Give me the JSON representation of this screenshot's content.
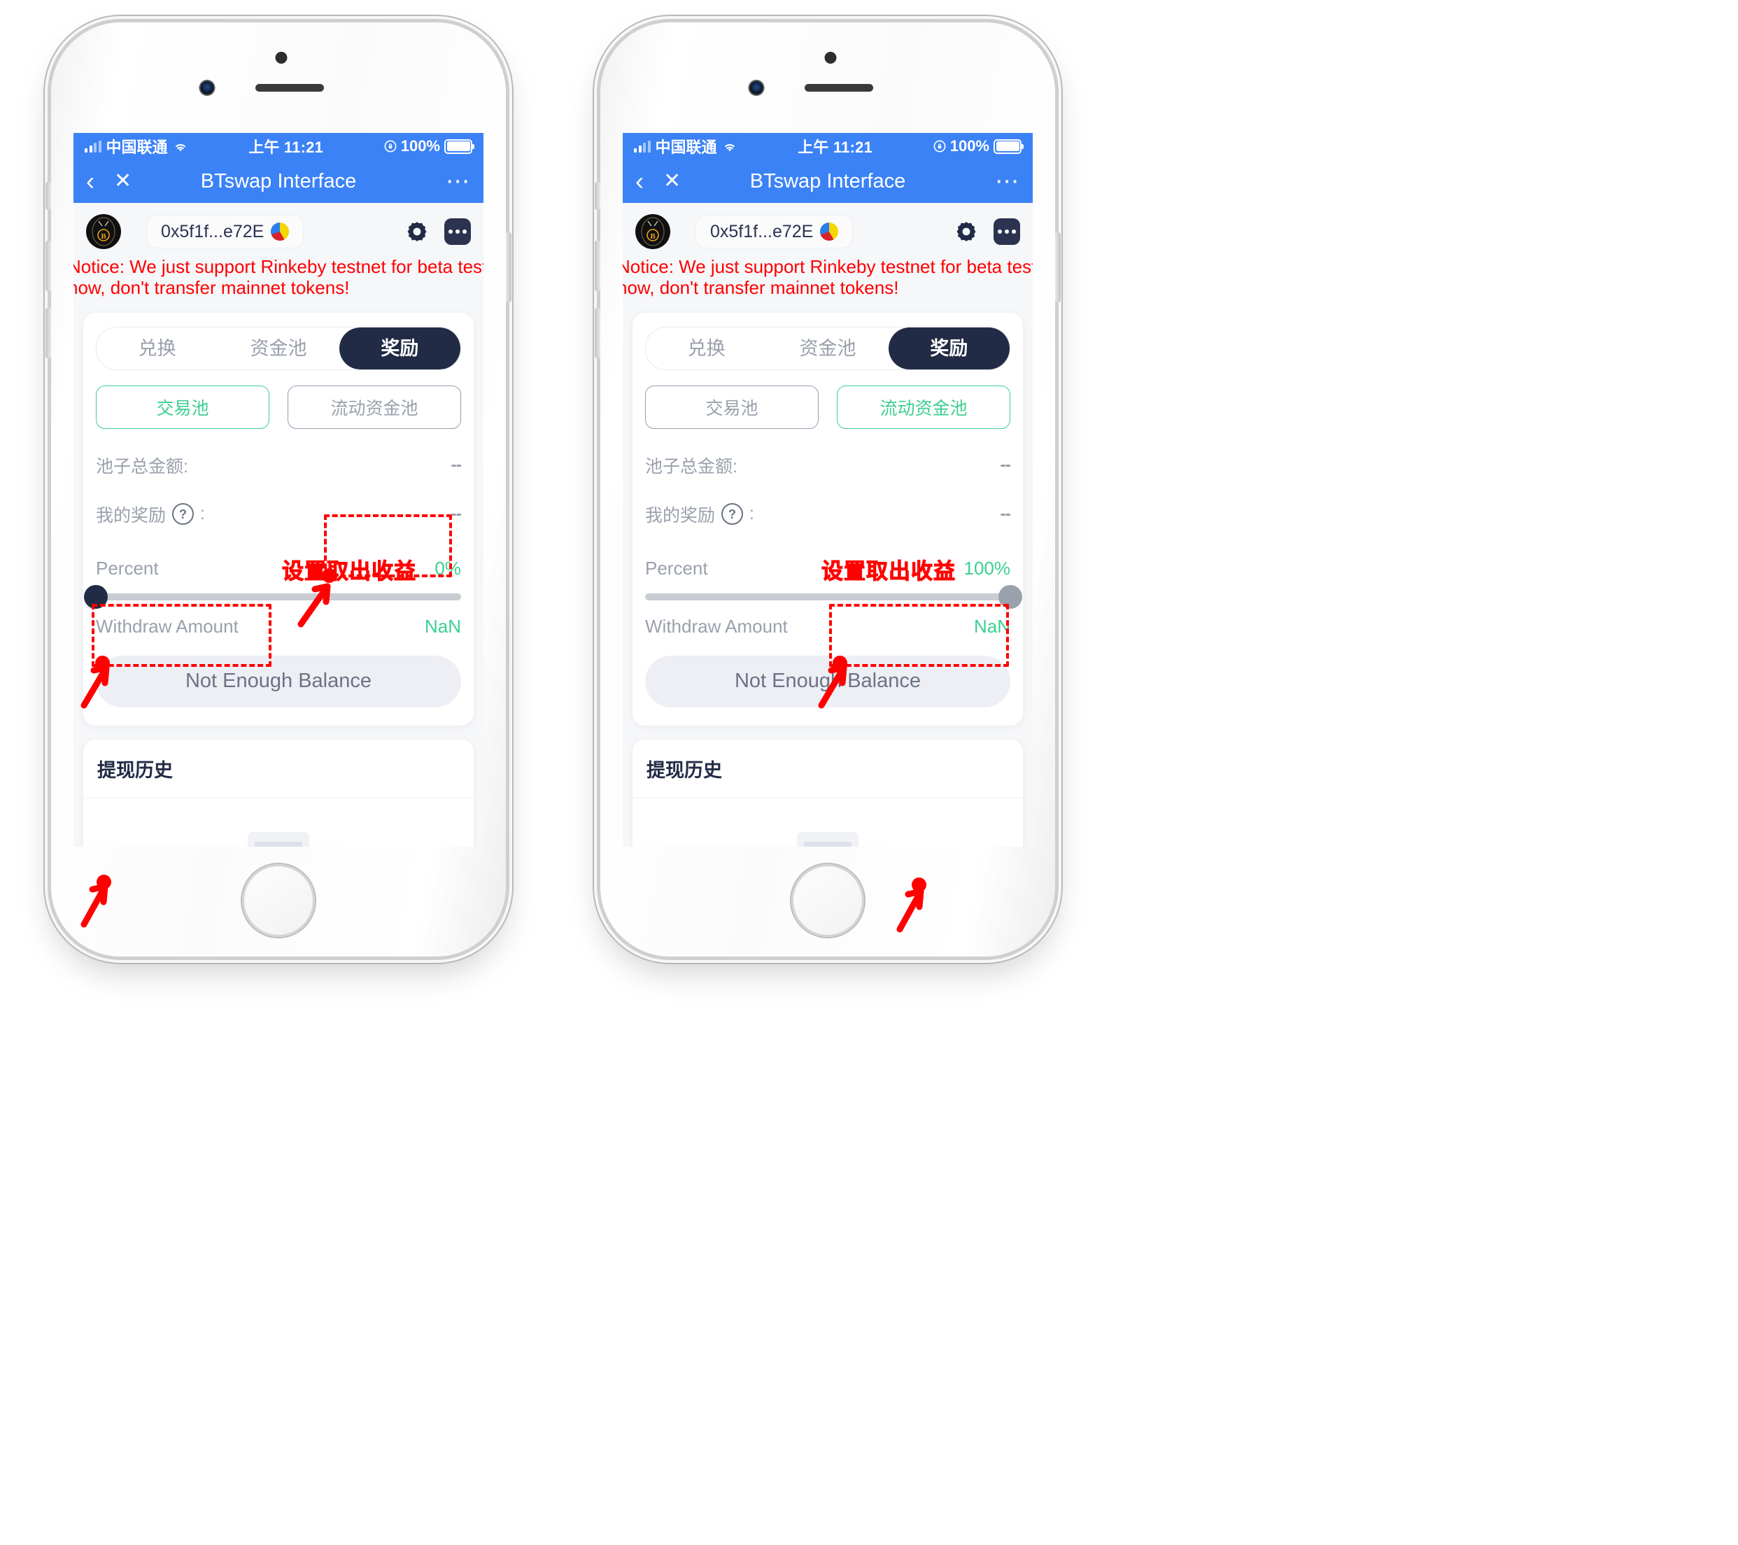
{
  "status_bar": {
    "carrier": "中国联通",
    "time": "上午 11:21",
    "battery_percent": "100%",
    "signal_icon": "signal-bars-icon",
    "wifi_icon": "wifi-icon",
    "lock_icon": "rotation-lock-icon",
    "battery_icon": "battery-icon"
  },
  "nav_bar": {
    "title": "BTswap Interface",
    "back_icon": "chevron-left-icon",
    "close_icon": "close-x-icon",
    "more_icon": "more-dots-icon"
  },
  "wallet": {
    "logo_icon": "btswap-bee-logo-icon",
    "address": "0x5f1f...e72E",
    "avatar_icon": "pie-avatar-icon",
    "settings_icon": "gear-icon",
    "more_icon": "more-menu-icon"
  },
  "notice": {
    "line1": "Notice: We just support Rinkeby testnet for beta test",
    "line2": "now, don't transfer mainnet tokens!",
    "color": "#ff0000"
  },
  "tabs": [
    {
      "label": "兑换",
      "active": false
    },
    {
      "label": "资金池",
      "active": false
    },
    {
      "label": "奖励",
      "active": true
    }
  ],
  "pools_left": [
    {
      "label": "交易池",
      "selected": true
    },
    {
      "label": "流动资金池",
      "selected": false
    }
  ],
  "pools_right": [
    {
      "label": "交易池",
      "selected": false
    },
    {
      "label": "流动资金池",
      "selected": true
    }
  ],
  "info_rows": [
    {
      "label": "池子总金额:",
      "value": "--",
      "has_help": false
    },
    {
      "label": "我的奖励",
      "suffix": ":",
      "value": "--",
      "has_help": true,
      "help_icon": "question-mark-icon"
    }
  ],
  "percent": {
    "label": "Percent",
    "value_left": "0%",
    "value_right": "100%",
    "accent": "#3ccf91"
  },
  "withdraw": {
    "label": "Withdraw Amount",
    "value": "NaN"
  },
  "action_button": {
    "label": "Not Enough Balance"
  },
  "history": {
    "title": "提现历史",
    "empty_icon": "empty-document-icon"
  },
  "annotations": {
    "callout_text": "设置取出收益",
    "color": "#ff0000",
    "left_phone": {
      "box_reward_tab": "奖励",
      "box_pool": "交易池",
      "slider_marker": "percent-slider-handle"
    },
    "right_phone": {
      "box_pool": "流动资金池",
      "slider_marker": "percent-slider-handle"
    }
  },
  "theme": {
    "status_blue": "#3b82f6",
    "dark_navy": "#222b45",
    "green": "#3ccf91",
    "muted": "#9aa0ac",
    "screen_bg": "#f6f7f9"
  }
}
